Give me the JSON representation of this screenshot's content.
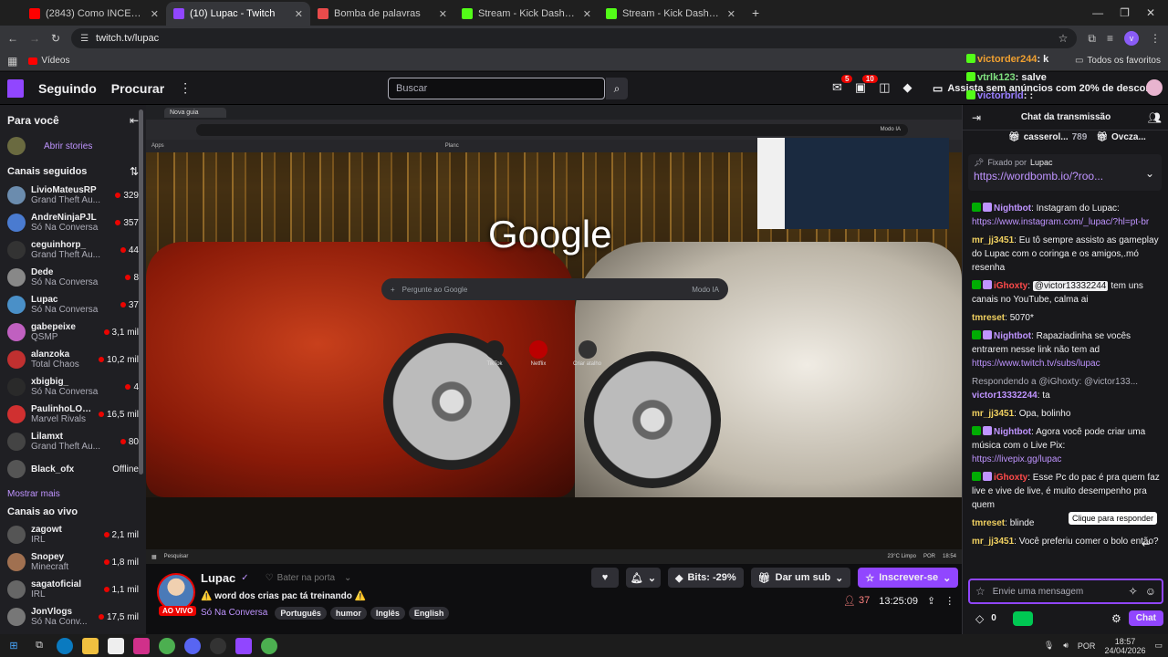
{
  "browser": {
    "tabs": [
      {
        "title": "(2843) Como INCENTIVAR as pessoas",
        "color": "#ff0000"
      },
      {
        "title": "(10) Lupac - Twitch",
        "color": "#9146ff",
        "active": true
      },
      {
        "title": "Bomba de palavras",
        "color": "#e94b4b"
      },
      {
        "title": "Stream - Kick Dashboard",
        "color": "#53fc18"
      },
      {
        "title": "Stream - Kick Dashboard",
        "color": "#53fc18"
      }
    ],
    "url": "twitch.tv/lupac",
    "bookmark": "Vídeos",
    "all_favorites": "Todos os favoritos"
  },
  "twitch_nav": {
    "following": "Seguindo",
    "browse": "Procurar",
    "search_placeholder": "Buscar",
    "notif_count": "5",
    "inbox_count": "10",
    "ad_free": "Assista sem anúncios com 20% de desconto"
  },
  "sidebar": {
    "for_you": "Para você",
    "open_stories": "Abrir stories",
    "followed_title": "Canais seguidos",
    "followed": [
      {
        "name": "LivioMateusRP",
        "game": "Grand Theft Au...",
        "viewers": "329",
        "color": "#6b8cae"
      },
      {
        "name": "AndreNinjaPJL",
        "game": "Só Na Conversa",
        "viewers": "357",
        "color": "#4a7bd0"
      },
      {
        "name": "ceguinhorp_",
        "game": "Grand Theft Au...",
        "viewers": "44",
        "color": "#333"
      },
      {
        "name": "Dede",
        "game": "Só Na Conversa",
        "viewers": "8",
        "color": "#888"
      },
      {
        "name": "Lupac",
        "game": "Só Na Conversa",
        "viewers": "37",
        "color": "#4a90c8"
      },
      {
        "name": "gabepeixe",
        "game": "QSMP",
        "viewers": "3,1 mil",
        "color": "#c060c0"
      },
      {
        "name": "alanzoka",
        "game": "Total Chaos",
        "viewers": "10,2 mil",
        "color": "#c03030"
      },
      {
        "name": "xbigbig_",
        "game": "Só Na Conversa",
        "viewers": "4",
        "color": "#2a2a2a"
      },
      {
        "name": "PaulinhoLOK...",
        "game": "Marvel Rivals",
        "viewers": "16,5 mil",
        "color": "#d03030"
      },
      {
        "name": "Lilamxt",
        "game": "Grand Theft Au...",
        "viewers": "80",
        "color": "#444"
      },
      {
        "name": "Black_ofx",
        "game": "",
        "viewers": "Offline",
        "color": "#555"
      }
    ],
    "show_more": "Mostrar mais",
    "live_title": "Canais ao vivo",
    "live": [
      {
        "name": "zagowt",
        "game": "IRL",
        "viewers": "2,1 mil",
        "color": "#555"
      },
      {
        "name": "Snopey",
        "game": "Minecraft",
        "viewers": "1,8 mil",
        "color": "#a07050"
      },
      {
        "name": "sagatoficial",
        "game": "IRL",
        "viewers": "1,1 mil",
        "color": "#666"
      },
      {
        "name": "JonVlogs",
        "game": "Só Na Conv...",
        "viewers": "17,5 mil",
        "color": "#777"
      }
    ]
  },
  "video": {
    "inner_tab": "Nova guia",
    "google": "Google",
    "google_search": "Pergunte ao Google",
    "ai_mode": "Modo IA",
    "shortcut_tiktok": "TikTok",
    "shortcut_netflix": "Netflix",
    "shortcut_add": "Criar atalho",
    "inner_taskbar_search": "Pesquisar",
    "weather": "23°C Limpo",
    "inner_lang": "POR",
    "inner_time": "18:54",
    "bookmarks": [
      "Apps",
      "Planc"
    ]
  },
  "stream": {
    "channel": "Lupac",
    "hype": "Bater na porta",
    "live_label": "AO VIVO",
    "title": "⚠️ word dos crias pac tá treinando ⚠️",
    "category": "Só Na Conversa",
    "tags": [
      "Português",
      "humor",
      "Inglês",
      "English"
    ],
    "bits": "Bits: -29%",
    "gift": "Dar um sub",
    "subscribe": "Inscrever-se",
    "viewers": "37",
    "uptime": "13:25:09"
  },
  "chat": {
    "header": "Chat da transmissão",
    "overlay": [
      {
        "user": "victorder244",
        "text": "k",
        "color": "#f0a030"
      },
      {
        "user": "vtrlk123",
        "text": "salve",
        "color": "#7fe07f"
      },
      {
        "user": "victorbrld",
        "text": ":",
        "color": "#9a7fff"
      }
    ],
    "leaderboard": [
      {
        "name": "casserol...",
        "value": "789"
      },
      {
        "name": "Ovcza...",
        "value": ""
      }
    ],
    "pinned_by": "Fixado por",
    "pinned_user": "Lupac",
    "pinned_link": "https://wordbomb.io/?roo...",
    "messages": [
      {
        "user": "Nightbot",
        "color": "#bf94ff",
        "text": "Instagram do Lupac:",
        "link": "https://www.instagram.com/_lupac/?hl=pt-br"
      },
      {
        "user": "mr_jj3451",
        "color": "#f0d060",
        "text": "Eu tô sempre assisto as gameplay do Lupac com o coringa e os amigos,.mó resenha"
      },
      {
        "user": "iGhoxty",
        "color": "#ff4a4a",
        "mention": "@victor13332244",
        "text": "tem uns canais no YouTube, calma ai"
      },
      {
        "user": "tmreset",
        "color": "#f0d060",
        "text": "5070*"
      },
      {
        "user": "Nightbot",
        "color": "#bf94ff",
        "text": "Rapaziadinha se vocês entrarem nesse link não tem ad",
        "link": "https://www.twitch.tv/subs/lupac"
      },
      {
        "reply": "Respondendo a @iGhoxty: @victor133...",
        "user": "victor13332244",
        "color": "#bf94ff",
        "text": "ta"
      },
      {
        "user": "mr_jj3451",
        "color": "#f0d060",
        "text": "Opa, bolinho"
      },
      {
        "user": "Nightbot",
        "color": "#bf94ff",
        "text": "Agora você pode criar uma música com o Live Pix:",
        "link": "https://livepix.gg/lupac"
      },
      {
        "user": "iGhoxty",
        "color": "#ff4a4a",
        "text": "Esse Pc do pac é pra quem faz live e vive de live, é muito desempenho pra quem"
      },
      {
        "user": "tmreset",
        "color": "#f0d060",
        "text": "blinde"
      },
      {
        "user": "mr_jj3451",
        "color": "#f0d060",
        "text": "Você preferiu comer o bolo então?"
      }
    ],
    "tooltip": "Clique para responder",
    "input_placeholder": "Envie uma mensagem",
    "points": "0",
    "send": "Chat"
  },
  "taskbar": {
    "lang": "POR",
    "time": "18:57",
    "date": "24/04/2026"
  }
}
